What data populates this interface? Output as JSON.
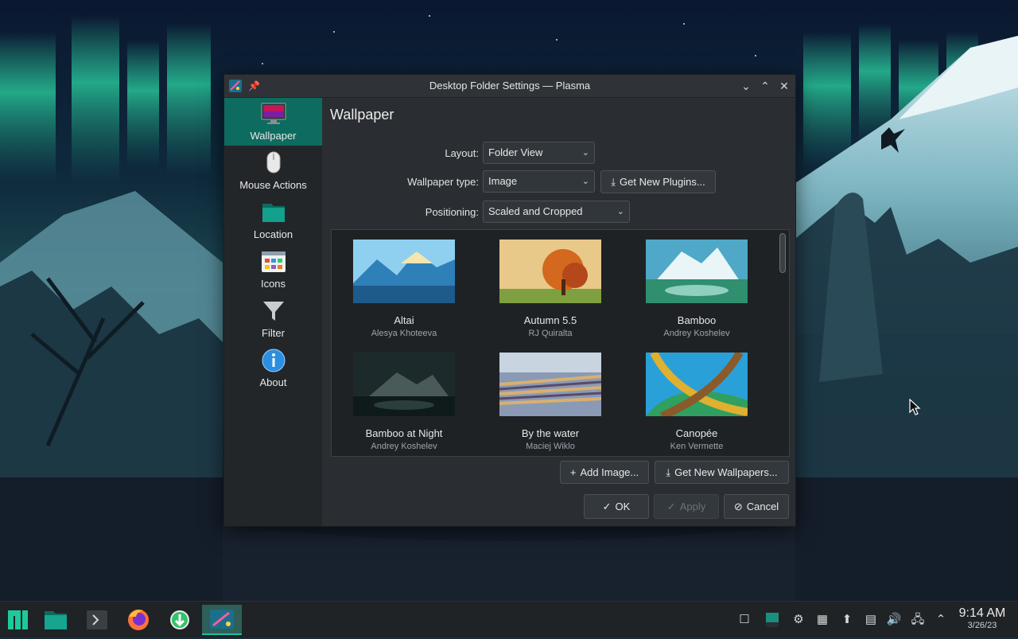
{
  "window": {
    "title": "Desktop Folder Settings — Plasma",
    "minimize_glyph": "⌄",
    "maximize_glyph": "⌃",
    "close_glyph": "✕"
  },
  "sidebar": {
    "items": [
      {
        "label": "Wallpaper",
        "icon": "monitor-icon",
        "active": true
      },
      {
        "label": "Mouse Actions",
        "icon": "mouse-icon",
        "active": false
      },
      {
        "label": "Location",
        "icon": "folder-icon",
        "active": false
      },
      {
        "label": "Icons",
        "icon": "icons-grid-icon",
        "active": false
      },
      {
        "label": "Filter",
        "icon": "filter-icon",
        "active": false
      },
      {
        "label": "About",
        "icon": "info-icon",
        "active": false
      }
    ]
  },
  "main": {
    "title": "Wallpaper",
    "layout": {
      "label": "Layout:",
      "value": "Folder View"
    },
    "wallpaper_type": {
      "label": "Wallpaper type:",
      "value": "Image"
    },
    "get_new_plugins": "Get New Plugins...",
    "positioning": {
      "label": "Positioning:",
      "value": "Scaled and Cropped"
    },
    "wallpapers": [
      {
        "name": "Altai",
        "author": "Alesya Khoteeva"
      },
      {
        "name": "Autumn 5.5",
        "author": "RJ Quiralta"
      },
      {
        "name": "Bamboo",
        "author": "Andrey Koshelev"
      },
      {
        "name": "Bamboo at Night",
        "author": "Andrey Koshelev"
      },
      {
        "name": "By the water",
        "author": "Maciej Wiklo"
      },
      {
        "name": "Canopée",
        "author": "Ken Vermette"
      }
    ],
    "add_image": "Add Image...",
    "get_new_wallpapers": "Get New Wallpapers...",
    "ok": "OK",
    "apply": "Apply",
    "cancel": "Cancel"
  },
  "taskbar": {
    "apps": [
      "application-launcher-icon",
      "file-manager-icon",
      "terminal-icon",
      "firefox-icon",
      "software-center-icon",
      "plasma-settings-icon"
    ],
    "clock_time": "9:14 AM",
    "clock_date": "3/26/23"
  },
  "colors": {
    "accent": "#0d6b5f",
    "window_bg": "#2a2e32",
    "sidebar_bg": "#232629",
    "taskbar_bg": "#1f2326"
  }
}
